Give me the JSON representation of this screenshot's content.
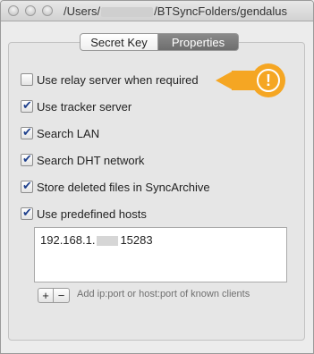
{
  "window": {
    "title_prefix": "/Users/",
    "title_suffix": "/BTSyncFolders/gendalus"
  },
  "tabs": [
    {
      "label": "Secret Key",
      "active": false
    },
    {
      "label": "Properties",
      "active": true
    }
  ],
  "options": [
    {
      "label": "Use relay server when required",
      "checked": false
    },
    {
      "label": "Use tracker server",
      "checked": true
    },
    {
      "label": "Search LAN",
      "checked": true
    },
    {
      "label": "Search DHT network",
      "checked": true
    },
    {
      "label": "Store deleted files in SyncArchive",
      "checked": true
    },
    {
      "label": "Use predefined hosts",
      "checked": true
    }
  ],
  "hosts": {
    "entry_prefix": "192.168.1.",
    "entry_suffix": "15283"
  },
  "controls": {
    "add_label": "+",
    "remove_label": "−",
    "hint": "Add ip:port or host:port of known clients"
  },
  "colors": {
    "accent_warning": "#f5a623",
    "checkmark": "#1d3f8c",
    "active_tab": "#7b7b7b"
  },
  "icons": {
    "warning": "exclamation-circle"
  }
}
